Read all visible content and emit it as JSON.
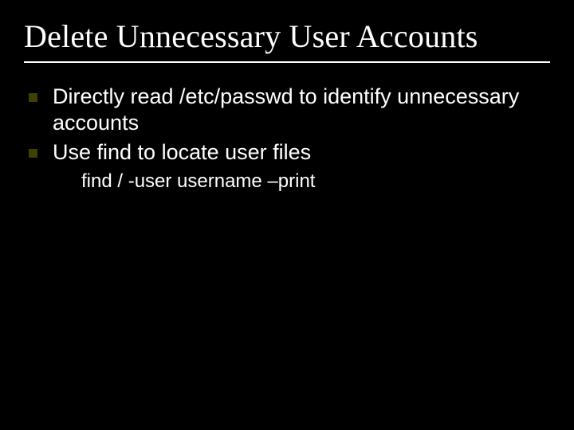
{
  "slide": {
    "title": "Delete Unnecessary User Accounts",
    "bullets": [
      {
        "text": "Directly read /etc/passwd to identify unnecessary accounts"
      },
      {
        "text": "Use find to locate user files"
      }
    ],
    "sub_item": "find / -user username –print"
  }
}
